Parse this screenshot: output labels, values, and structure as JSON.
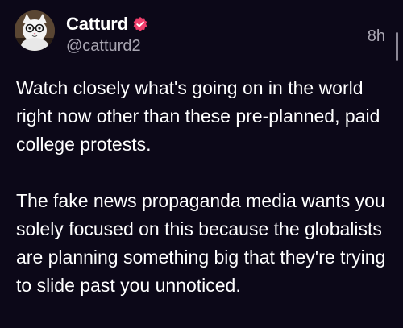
{
  "post": {
    "author": {
      "display_name": "Catturd",
      "handle": "@catturd2",
      "verified": true,
      "avatar_icon": "cat-avatar-icon"
    },
    "timestamp": "8h",
    "paragraphs": [
      "Watch closely what's going on in the world right now other than these pre-planned, paid college protests.",
      "The fake news propaganda media wants you solely focused on this because the globalists are planning something big that they're trying to slide past you unnoticed."
    ]
  },
  "colors": {
    "background": "#0c0818",
    "text": "#ffffff",
    "muted_text": "#a9a6b2",
    "verified_badge": "#ee3e6b"
  }
}
